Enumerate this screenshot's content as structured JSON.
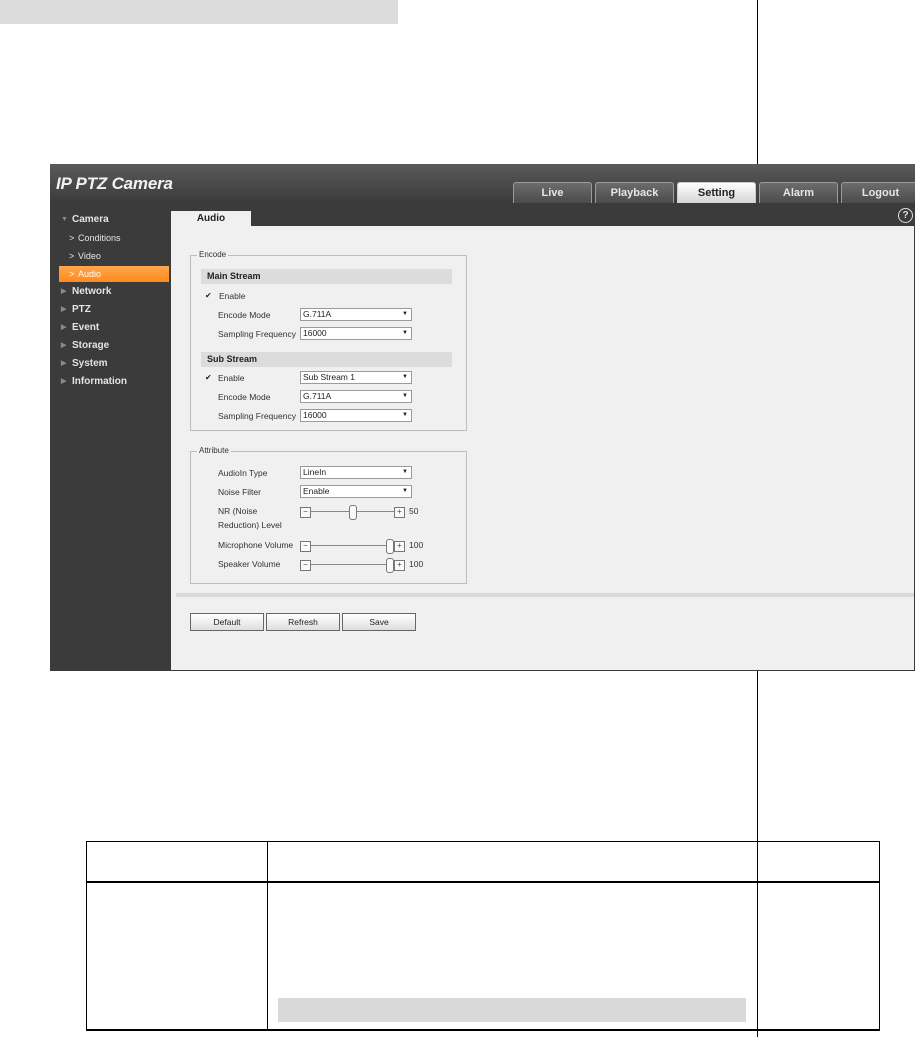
{
  "window": {
    "title": "IP PTZ Camera"
  },
  "nav": {
    "tabs": [
      {
        "label": "Live",
        "active": false
      },
      {
        "label": "Playback",
        "active": false
      },
      {
        "label": "Setting",
        "active": true
      },
      {
        "label": "Alarm",
        "active": false
      },
      {
        "label": "Logout",
        "active": false
      }
    ]
  },
  "sidebar": {
    "camera": "Camera",
    "camera_items": [
      "Conditions",
      "Video",
      "Audio"
    ],
    "groups": [
      "Network",
      "PTZ",
      "Event",
      "Storage",
      "System",
      "Information"
    ]
  },
  "page": {
    "tab": "Audio"
  },
  "encode": {
    "legend": "Encode",
    "main_stream": {
      "header": "Main Stream",
      "enable_label": "Enable",
      "enabled": true,
      "encode_mode_label": "Encode Mode",
      "encode_mode": "G.711A",
      "sampling_label": "Sampling Frequency",
      "sampling": "16000"
    },
    "sub_stream": {
      "header": "Sub Stream",
      "enable_label": "Enable",
      "enabled": true,
      "stream": "Sub Stream 1",
      "encode_mode_label": "Encode Mode",
      "encode_mode": "G.711A",
      "sampling_label": "Sampling Frequency",
      "sampling": "16000"
    }
  },
  "attribute": {
    "legend": "Attribute",
    "audioin_label": "AudioIn Type",
    "audioin": "LineIn",
    "noise_label": "Noise Filter",
    "noise": "Enable",
    "nr_label_1": "NR (Noise",
    "nr_label_2": "Reduction) Level",
    "nr_value": "50",
    "mic_label": "Microphone Volume",
    "mic_value": "100",
    "speaker_label": "Speaker Volume",
    "speaker_value": "100"
  },
  "buttons": {
    "default": "Default",
    "refresh": "Refresh",
    "save": "Save"
  },
  "colors": {
    "accent": "#ff8a1a",
    "panel": "#f0f0f0",
    "chrome": "#3b3b3b"
  }
}
